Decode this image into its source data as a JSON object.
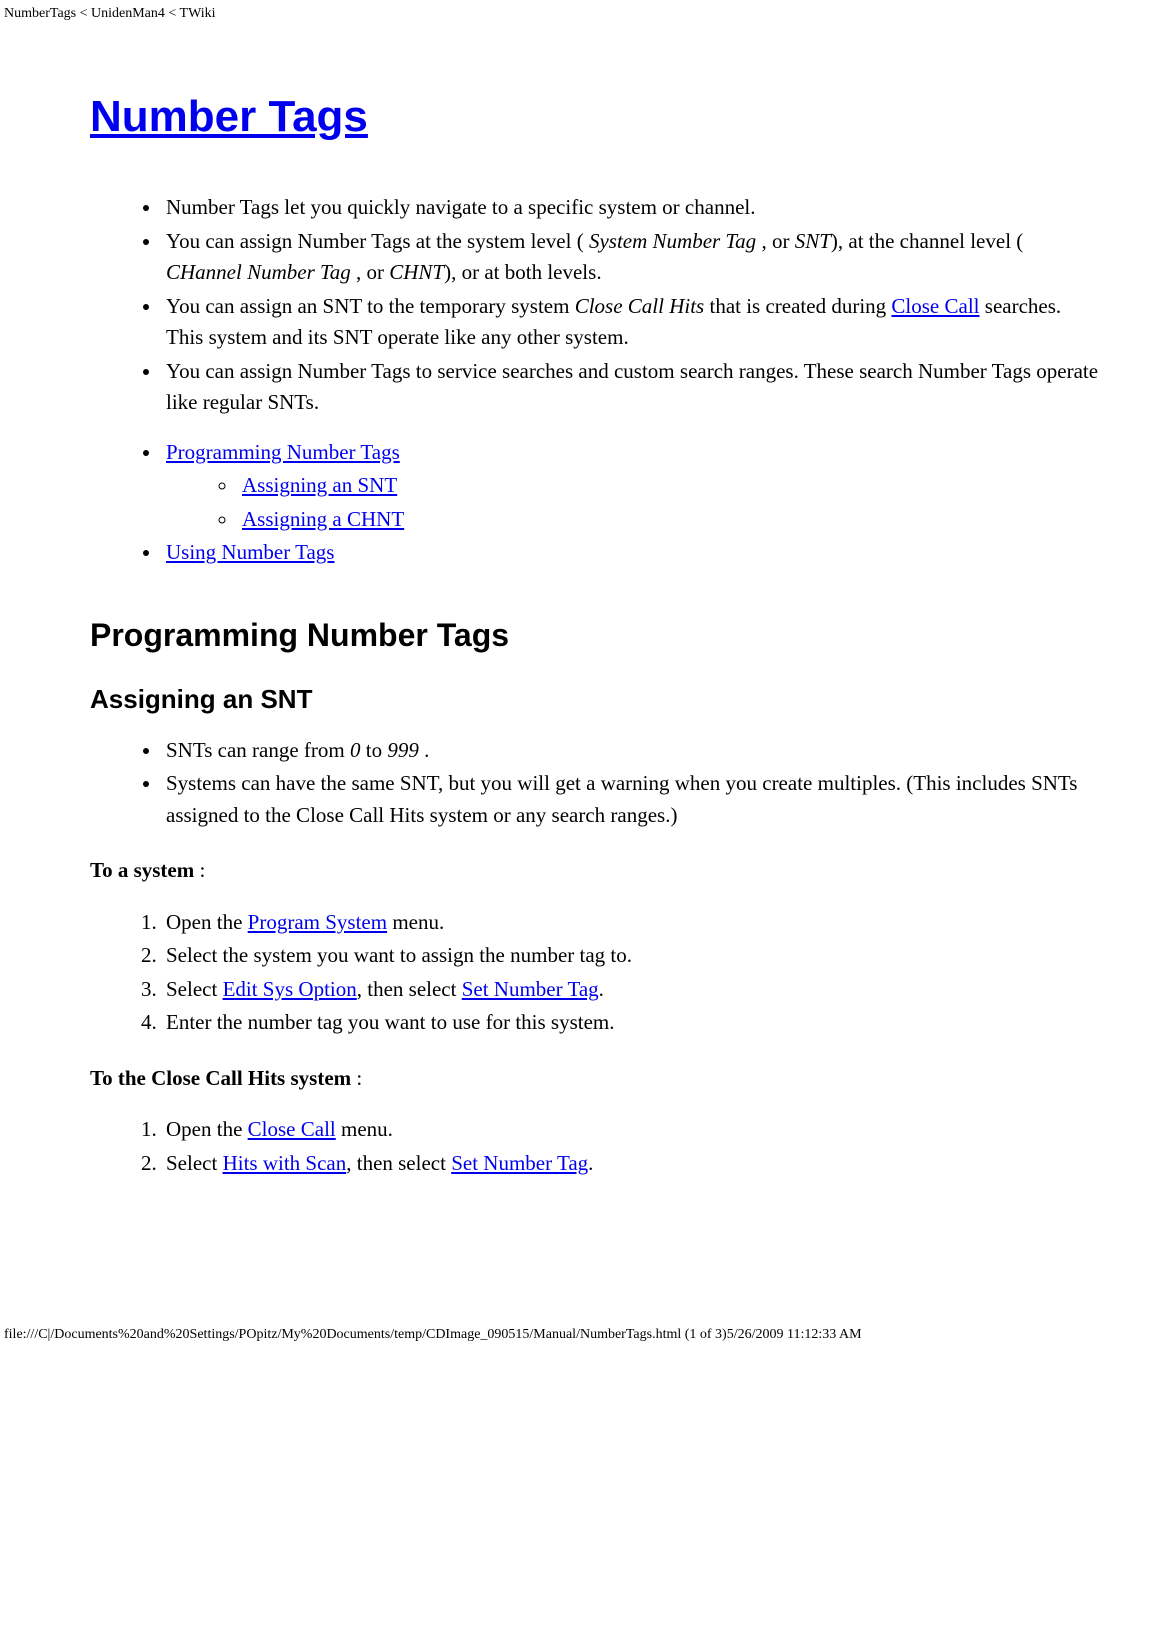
{
  "page_header": "NumberTags < UnidenMan4 < TWiki",
  "title_link": "Number Tags",
  "intro": {
    "b1_a": "Number Tags let you quickly navigate to a specific system or channel.",
    "b2_a": "You can assign Number Tags at the system level ( ",
    "b2_i1": "System Number Tag",
    "b2_b": " , or ",
    "b2_i2": "SNT",
    "b2_c": "), at the channel level ( ",
    "b2_i3": "CHannel Number Tag",
    "b2_d": " , or ",
    "b2_i4": "CHNT",
    "b2_e": "), or at both levels.",
    "b3_a": "You can assign an SNT to the temporary system ",
    "b3_i1": "Close Call Hits",
    "b3_b": " that is created during ",
    "b3_link": "Close Call",
    "b3_c": " searches. This system and its SNT operate like any other system.",
    "b4_a": "You can assign Number Tags to service searches and custom search ranges. These search Number Tags operate like regular SNTs."
  },
  "toc": {
    "l1a": "Programming Number Tags",
    "l2a": "Assigning an SNT",
    "l2b": "Assigning a CHNT",
    "l1b": "Using Number Tags"
  },
  "h2_prog": "Programming Number Tags",
  "h3_snt": "Assigning an SNT",
  "snt_bullets": {
    "b1_a": "SNTs can range from ",
    "b1_i1": "0",
    "b1_b": " to ",
    "b1_i2": "999",
    "b1_c": " .",
    "b2_a": "Systems can have the same SNT, but you will get a warning when you create multiples. (This includes SNTs assigned to the Close Call Hits system or any search ranges.)"
  },
  "to_system_label": "To a system",
  "to_system_colon": " :",
  "sys_steps": {
    "s1_a": "Open the ",
    "s1_link": "Program System",
    "s1_b": " menu.",
    "s2": "Select the system you want to assign the number tag to.",
    "s3_a": "Select ",
    "s3_link1": "Edit Sys Option",
    "s3_b": ", then select ",
    "s3_link2": "Set Number Tag",
    "s3_c": ".",
    "s4": "Enter the number tag you want to use for this system."
  },
  "to_cch_label": "To the Close Call Hits system",
  "to_cch_colon": " :",
  "cch_steps": {
    "s1_a": "Open the ",
    "s1_link": "Close Call",
    "s1_b": " menu.",
    "s2_a": "Select ",
    "s2_link1": "Hits with Scan",
    "s2_b": ", then select ",
    "s2_link2": "Set Number Tag",
    "s2_c": "."
  },
  "footer": "file:///C|/Documents%20and%20Settings/POpitz/My%20Documents/temp/CDImage_090515/Manual/NumberTags.html (1 of 3)5/26/2009 11:12:33 AM"
}
